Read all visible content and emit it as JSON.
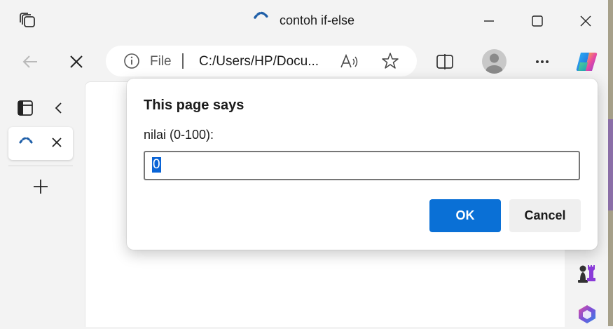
{
  "window": {
    "title": "contoh if-else"
  },
  "toolbar": {
    "file_label": "File",
    "address": "C:/Users/HP/Docu..."
  },
  "icons": {
    "tab_actions": "tab-actions-icon",
    "loading": "loading-spinner-icon",
    "minimize": "minimize-icon",
    "maximize": "maximize-icon",
    "close": "close-icon",
    "back": "back-arrow-icon",
    "stop": "stop-loading-icon",
    "info": "info-icon",
    "read_aloud": "read-aloud-icon",
    "favorite": "star-icon",
    "split_screen": "split-screen-icon",
    "profile": "profile-avatar",
    "more": "more-icon",
    "copilot": "copilot-icon",
    "panel": "vertical-tabs-panel-icon",
    "collapse": "chevron-left-icon",
    "new_tab": "plus-icon",
    "chess": "chess-game-icon",
    "m365": "microsoft-365-icon"
  },
  "dialog": {
    "title": "This page says",
    "message": "nilai (0-100):",
    "input_value": "0",
    "ok_label": "OK",
    "cancel_label": "Cancel"
  },
  "colors": {
    "accent": "#0a70d6",
    "chrome_bg": "#f3f3f3"
  }
}
